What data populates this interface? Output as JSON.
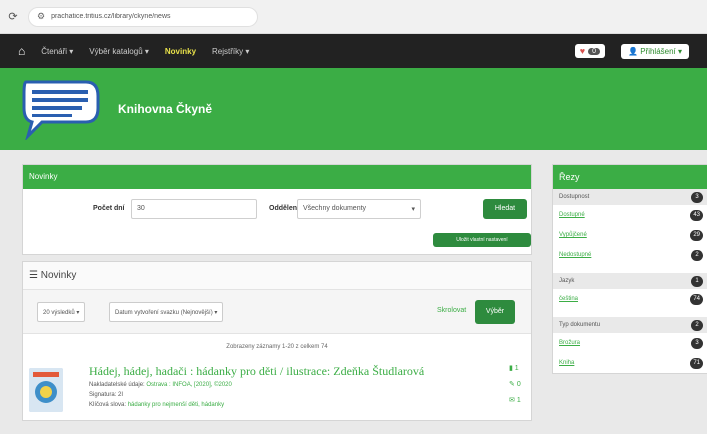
{
  "browser": {
    "url": "prachatice.tritius.cz/library/ckyne/news"
  },
  "navbar": {
    "items": [
      "Čtenáři ▾",
      "Výběr katalogů ▾",
      "Novinky",
      "Rejstříky ▾"
    ],
    "favorites_count": "0",
    "login": "Přihlášení ▾"
  },
  "banner": {
    "title": "Knihovna Čkyně"
  },
  "filter": {
    "heading": "Novinky",
    "days_label": "Počet dní",
    "days_value": "30",
    "type_label": "Oddělení",
    "type_value": "Všechny dokumenty",
    "show_button": "Hledat",
    "save_button": "Uložit vlastní nastavení"
  },
  "list": {
    "heading": "Novinky",
    "per_page": "20 výsledků ▾",
    "sort": "Datum vytvoření svazku (Nejnovější) ▾",
    "link1": "Skrolovat",
    "select_button": "Výběr",
    "records_info": "Zobrazeny záznamy 1-20 z celkem 74"
  },
  "record": {
    "title": "Hádej, hádej, hadači : hádanky pro děti / ilustrace: Zdeňka Študlarová",
    "line1_label": "Nakladatelské údaje:",
    "line1_value": "Ostrava : INFOA, [2020], ©2020",
    "line2": "Signatura: 2I",
    "line3_label": "Klíčová slova:",
    "line3_value": "hádanky pro nejmenší děti, hádanky",
    "side_counts": [
      "1",
      "0",
      "1"
    ]
  },
  "sidebar": {
    "heading": "Řezy",
    "facets": [
      {
        "name": "Dostupnost",
        "count": "3",
        "items": [
          {
            "label": "Dostupné",
            "count": "43"
          },
          {
            "label": "Vypůjčené",
            "count": "29"
          },
          {
            "label": "Nedostupné",
            "count": "2"
          }
        ]
      },
      {
        "name": "Jazyk",
        "count": "1",
        "items": [
          {
            "label": "čeština",
            "count": "74"
          }
        ]
      },
      {
        "name": "Typ dokumentu",
        "count": "2",
        "items": [
          {
            "label": "Brožura",
            "count": "3"
          },
          {
            "label": "Kniha",
            "count": "71"
          }
        ]
      }
    ]
  }
}
